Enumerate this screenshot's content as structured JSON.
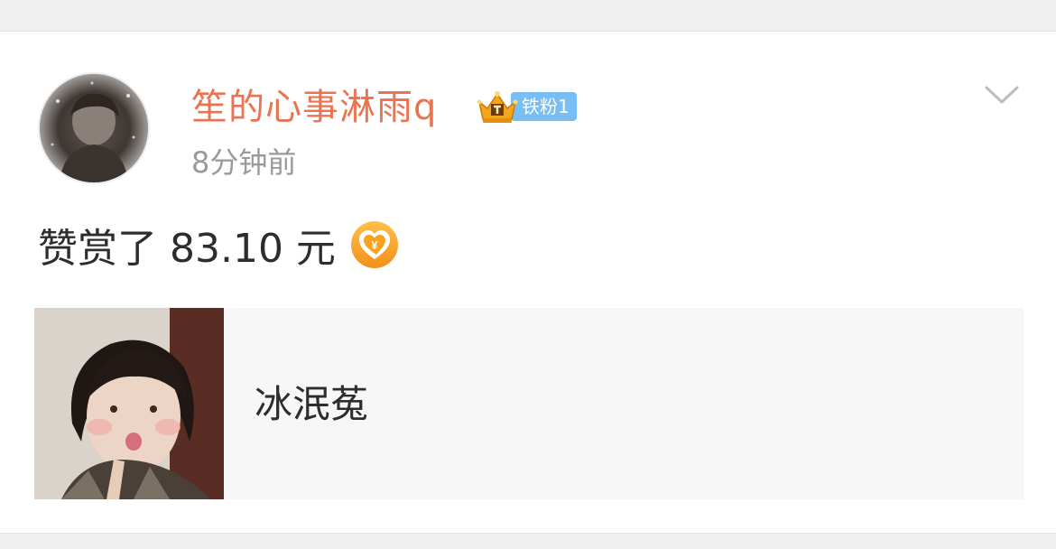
{
  "post": {
    "username": "笙的心事淋雨q",
    "fan_badge": "铁粉1",
    "timestamp": "8分钟前",
    "text": "赞赏了 83.10 元"
  },
  "link_card": {
    "title": "冰泯菟"
  },
  "icons": {
    "avatar": "user-avatar",
    "crown": "crown-icon",
    "reward": "heart-yuan-reward-icon",
    "dropdown": "chevron-down-icon"
  },
  "colors": {
    "username": "#eb7350",
    "fan_badge_bg": "#79bdf5",
    "timestamp": "#9a9a9a",
    "reward_icon": "#f5a623",
    "card_bg": "#f7f7f7"
  }
}
